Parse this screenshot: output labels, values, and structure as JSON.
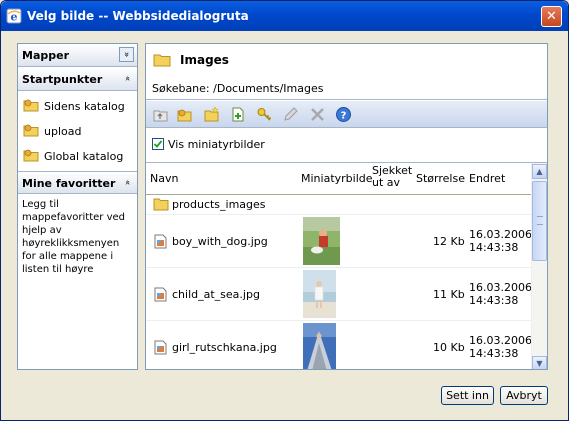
{
  "window": {
    "title": "Velg bilde -- Webbsidedialogruta",
    "close_symbol": "✕"
  },
  "left_panel": {
    "folders_title": "Mapper",
    "folders_toggle": "»",
    "startpoints_title": "Startpunkter",
    "startpoints_toggle": "«",
    "startpoints": [
      {
        "label": "Sidens katalog"
      },
      {
        "label": "upload"
      },
      {
        "label": "Global katalog"
      }
    ],
    "favorites_title": "Mine favoritter",
    "favorites_toggle": "«",
    "favorites_text": "Legg til mappefavoritter ved hjelp av høyreklikksmenyen for alle mappene i listen til høyre"
  },
  "right_panel": {
    "folder_title": "Images",
    "path_label": "Søkebane:",
    "path_value": "/Documents/Images",
    "toolbar_icons": [
      "folder-up-icon",
      "favorite-folder-icon",
      "new-folder-icon",
      "new-file-icon",
      "key-icon",
      "edit-icon",
      "delete-icon",
      "help-icon"
    ],
    "show_thumbnails_label": "Vis miniatyrbilder",
    "show_thumbnails_checked": true,
    "columns": {
      "name": "Navn",
      "thumbnail": "Miniatyrbilde",
      "checked_out_1": "Sjekket",
      "checked_out_2": "ut av",
      "size": "Størrelse",
      "modified": "Endret"
    },
    "rows": [
      {
        "type": "folder",
        "name": "products_images"
      },
      {
        "type": "image",
        "name": "boy_with_dog.jpg",
        "size": "12 Kb",
        "date": "16.03.2006",
        "time": "14:43:38"
      },
      {
        "type": "image",
        "name": "child_at_sea.jpg",
        "size": "11 Kb",
        "date": "16.03.2006",
        "time": "14:43:38"
      },
      {
        "type": "image",
        "name": "girl_rutschkana.jpg",
        "size": "10 Kb",
        "date": "16.03.2006",
        "time": "14:43:38"
      }
    ]
  },
  "buttons": {
    "insert": "Sett inn",
    "cancel": "Avbryt"
  },
  "colors": {
    "titlebar": "#0047CC",
    "panel_border": "#7F9DB9",
    "folder_yellow": "#F4D15C",
    "close_red": "#C5461E"
  }
}
